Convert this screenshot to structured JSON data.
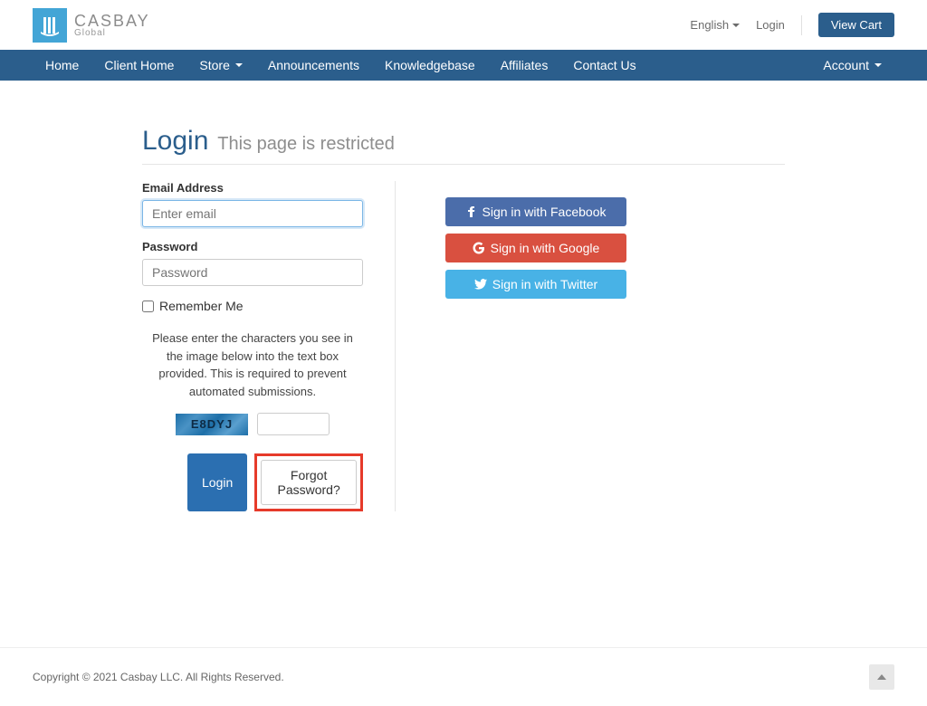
{
  "header": {
    "brand_main": "CASBAY",
    "brand_sub": "Global",
    "language": "English",
    "login": "Login",
    "view_cart": "View Cart"
  },
  "nav": {
    "items": [
      "Home",
      "Client Home",
      "Store",
      "Announcements",
      "Knowledgebase",
      "Affiliates",
      "Contact Us"
    ],
    "account": "Account"
  },
  "page": {
    "title": "Login",
    "subtitle": "This page is restricted"
  },
  "form": {
    "email_label": "Email Address",
    "email_placeholder": "Enter email",
    "password_label": "Password",
    "password_placeholder": "Password",
    "remember_label": "Remember Me",
    "captcha_instructions": "Please enter the characters you see in the image below into the text box provided. This is required to prevent automated submissions.",
    "captcha_code": "E8DYJ",
    "login_btn": "Login",
    "forgot_btn": "Forgot Password?"
  },
  "social": {
    "facebook": "Sign in with Facebook",
    "google": "Sign in with Google",
    "twitter": "Sign in with Twitter"
  },
  "footer": {
    "copyright": "Copyright © 2021 Casbay LLC. All Rights Reserved."
  }
}
